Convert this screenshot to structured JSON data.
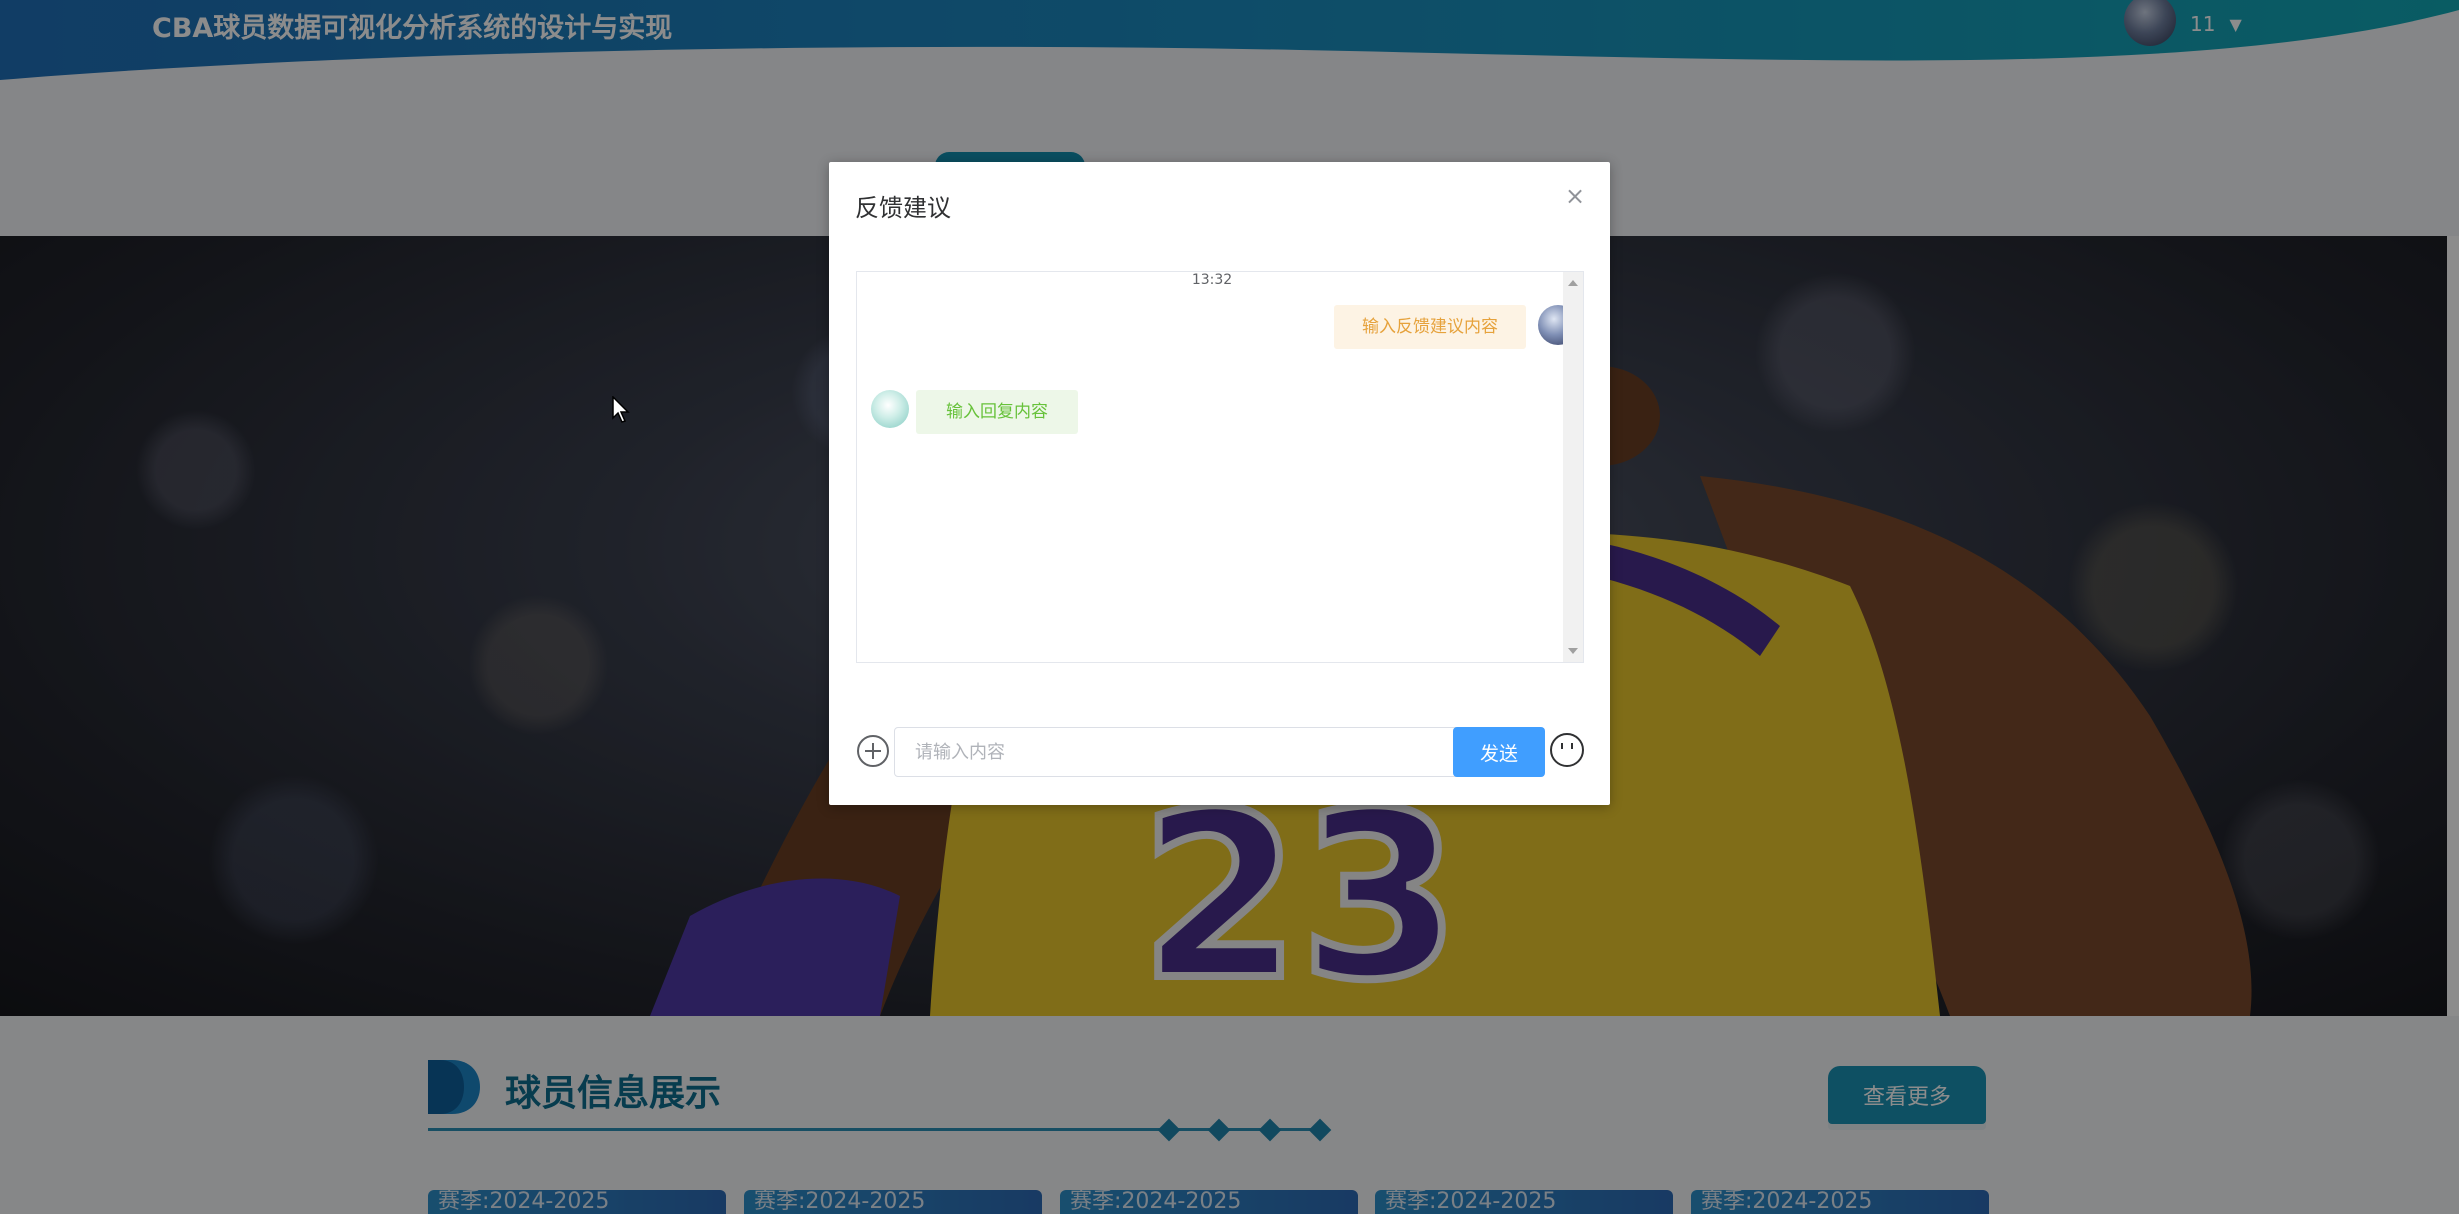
{
  "header": {
    "site_title": "CBA球员数据可视化分析系统的设计与实现",
    "user_name": "11",
    "caret": "▼"
  },
  "section": {
    "title": "球员信息展示",
    "more_label": "查看更多",
    "cards": [
      {
        "season": "赛季:2024-2025"
      },
      {
        "season": "赛季:2024-2025"
      },
      {
        "season": "赛季:2024-2025"
      },
      {
        "season": "赛季:2024-2025"
      },
      {
        "season": "赛季:2024-2025"
      }
    ]
  },
  "banner": {
    "jersey_number": "23"
  },
  "dialog": {
    "title": "反馈建议",
    "close": "×",
    "chat": {
      "time": "13:32",
      "user_message": "输入反馈建议内容",
      "reply_message": "输入回复内容"
    },
    "input_placeholder": "请输入内容",
    "input_value": "",
    "send_label": "发送"
  },
  "colors": {
    "brand": "#138fb0",
    "send": "#409eff",
    "user_bubble": "#fdf3e4",
    "reply_bubble": "#edf7e8"
  },
  "icons": [
    "add-circle-icon",
    "emoji-icon",
    "close-icon",
    "caret-down-icon",
    "cursor-icon"
  ]
}
